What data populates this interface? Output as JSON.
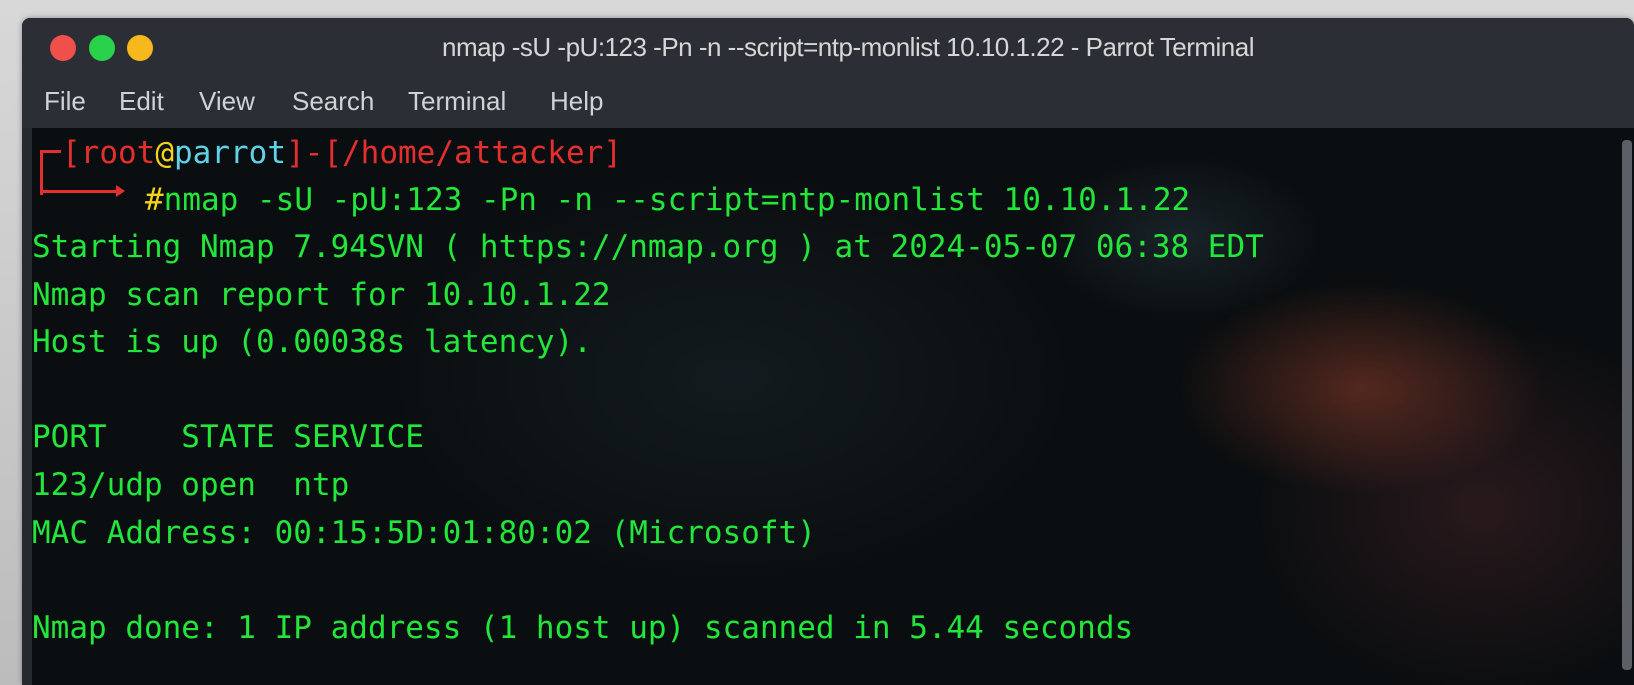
{
  "window": {
    "title": "nmap -sU -pU:123 -Pn -n --script=ntp-monlist 10.10.1.22 - Parrot Terminal"
  },
  "menu": {
    "items": [
      "File",
      "Edit",
      "View",
      "Search",
      "Terminal",
      "Help"
    ]
  },
  "prompt": {
    "open_bracket": "[",
    "user": "root",
    "at": "@",
    "host": "parrot",
    "close_bracket": "]",
    "dash": "-",
    "path_open": "[",
    "path": "/home/attacker",
    "path_close": "]",
    "hash": "#",
    "command": "nmap -sU -pU:123 -Pn -n --script=ntp-monlist 10.10.1.22"
  },
  "output": {
    "line1": "Starting Nmap 7.94SVN ( https://nmap.org ) at 2024-05-07 06:38 EDT",
    "line2": "Nmap scan report for 10.10.1.22",
    "line3": "Host is up (0.00038s latency).",
    "line4": "",
    "line5": "PORT    STATE SERVICE",
    "line6": "123/udp open  ntp",
    "line7": "MAC Address: 00:15:5D:01:80:02 (Microsoft)",
    "line8": "",
    "line9": "Nmap done: 1 IP address (1 host up) scanned in 5.44 seconds"
  },
  "colors": {
    "output_green": "#22e63a",
    "prompt_red": "#e52f2f",
    "prompt_yellow": "#f5d21b",
    "prompt_cyan": "#5fd2e6"
  }
}
